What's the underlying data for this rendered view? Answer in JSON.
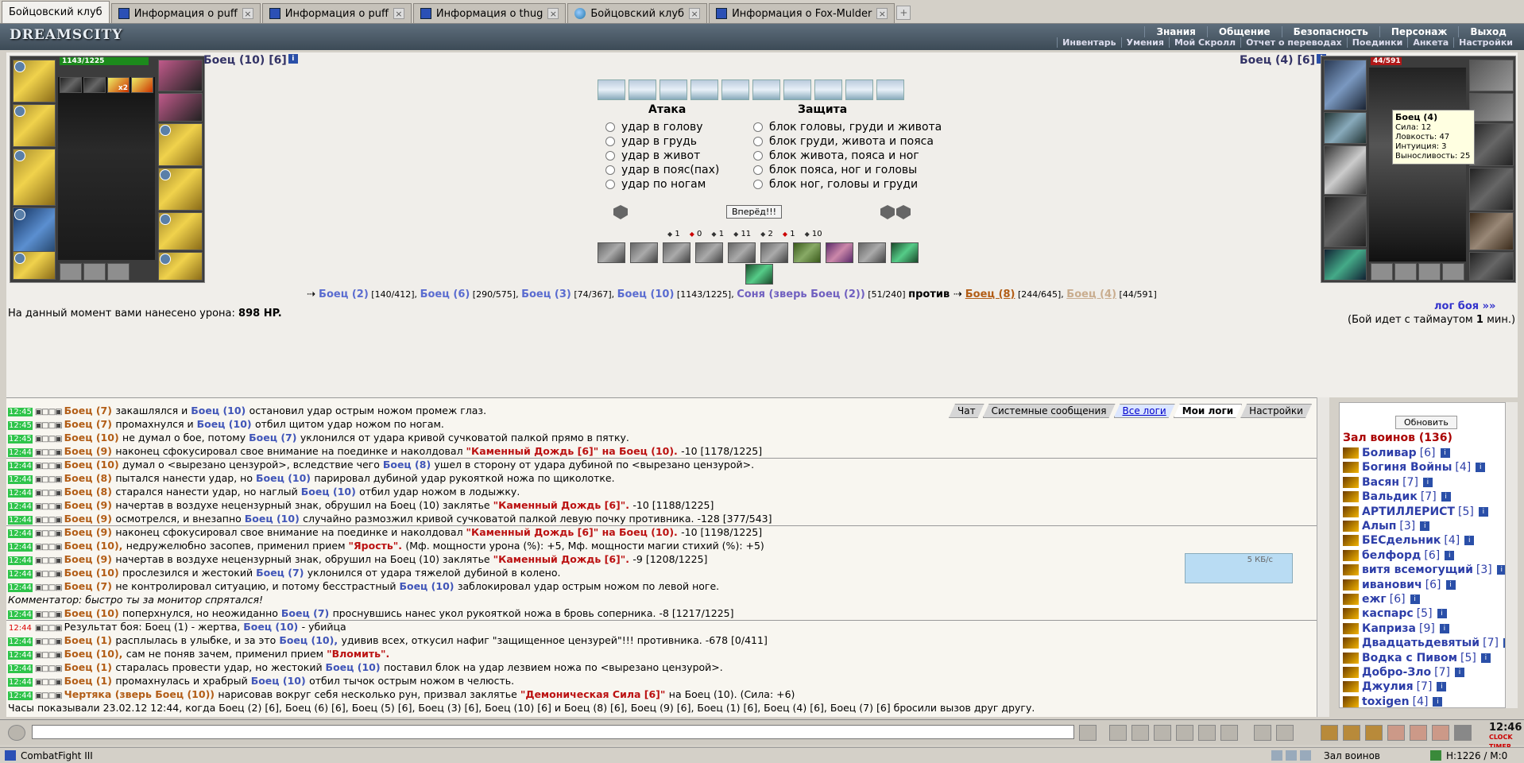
{
  "tabs": [
    {
      "label": "Бойцовский клуб",
      "icon": "dreamscity-icon"
    },
    {
      "label": "Информация о puff",
      "icon": "ie-icon"
    },
    {
      "label": "Информация о puff",
      "icon": "ie-icon"
    },
    {
      "label": "Информация о thug",
      "icon": "ie-icon"
    },
    {
      "label": "Бойцовский клуб",
      "icon": "globe-icon"
    },
    {
      "label": "Информация о Fox-Mulder",
      "icon": "ie-icon"
    }
  ],
  "header": {
    "logo": "DREAMSCITY",
    "menu_top": [
      "Знания",
      "Общение",
      "Безопасность",
      "Персонаж",
      "Выход"
    ],
    "menu_bottom": [
      "Инвентарь",
      "Умения",
      "Мой Скролл",
      "Отчет о переводах",
      "Поединки",
      "Анкета",
      "Настройки"
    ]
  },
  "player_left": {
    "name": "Боец (10) [6]",
    "hp": "1143/1225",
    "hp_fraction": 0.933,
    "buff": "x2"
  },
  "player_right": {
    "name": "Боец (4) [6]",
    "hp": "44/591",
    "hp_fraction": 0.074
  },
  "tooltip": {
    "title": "Боец (4)",
    "lines": [
      "Сила: 12",
      "Ловкость: 47",
      "Интуиция: 3",
      "Выносливость: 25"
    ]
  },
  "attack": {
    "title": "Атака",
    "options": [
      "удар в голову",
      "удар в грудь",
      "удар в живот",
      "удар в пояс(пах)",
      "удар по ногам"
    ]
  },
  "defense": {
    "title": "Защита",
    "options": [
      "блок головы, груди и живота",
      "блок груди, живота и пояса",
      "блок живота, пояса и ног",
      "блок пояса, ног и головы",
      "блок ног, головы и груди"
    ]
  },
  "go_button": "Вперёд!!!",
  "stats": [
    "1",
    "0",
    "1",
    "11",
    "2",
    "1",
    "10"
  ],
  "fighters": {
    "team1": [
      {
        "name": "Боец (2)",
        "hp": "[140/412]"
      },
      {
        "name": "Боец (6)",
        "hp": "[290/575]"
      },
      {
        "name": "Боец (3)",
        "hp": "[74/367]"
      },
      {
        "name": "Боец (10)",
        "hp": "[1143/1225]"
      },
      {
        "name": "Соня (зверь Боец (2))",
        "hp": "[51/240]"
      }
    ],
    "versus": "против",
    "team2": [
      {
        "name": "Боец (8)",
        "hp": "[244/645]"
      },
      {
        "name": "Боец (4)",
        "hp": "[44/591]"
      }
    ]
  },
  "damage": {
    "label": "На данный момент вами нанесено урона:",
    "value": "898 HP."
  },
  "log_link": "лог боя »»",
  "timeout": {
    "text": "(Бой идет с таймаутом",
    "num": "1",
    "unit": "мин.)"
  },
  "log_tabs": [
    "Чат",
    "Системные сообщения",
    "Все логи",
    "Мои логи",
    "Настройки"
  ],
  "log_lines": [
    {
      "t": "12:45",
      "a": "Боец (7)",
      "x": "закашлялся и",
      "b": "Боец (10)",
      "y": "остановил удар острым ножом промеж глаз."
    },
    {
      "t": "12:45",
      "a": "Боец (7)",
      "x": "промахнулся и",
      "b": "Боец (10)",
      "y": "отбил щитом удар ножом по ногам."
    },
    {
      "t": "12:45",
      "a": "Боец (10)",
      "x": "не думал о бое, потому",
      "b": "Боец (7)",
      "y": "уклонился от удара кривой сучковатой палкой прямо в пятку."
    },
    {
      "t": "12:44",
      "a": "Боец (9)",
      "x": "наконец сфокусировал свое внимание на поединке и наколдовал",
      "b": "\"Каменный Дождь [6]\" на Боец (10).",
      "y": "-10 [1178/1225]"
    },
    {
      "t": "12:44",
      "a": "Боец (10)",
      "x": "думал о <вырезано цензурой>, вследствие чего",
      "b": "Боец (8)",
      "y": "ушел в сторону от удара дубиной по <вырезано цензурой>."
    },
    {
      "t": "12:44",
      "a": "Боец (8)",
      "x": "пытался нанести удар, но",
      "b": "Боец (10)",
      "y": "парировал дубиной удар рукояткой ножа по щиколотке."
    },
    {
      "t": "12:44",
      "a": "Боец (8)",
      "x": "старался нанести удар, но наглый",
      "b": "Боец (10)",
      "y": "отбил удар ножом в лодыжку."
    },
    {
      "t": "12:44",
      "a": "Боец (9)",
      "x": "начертав в воздухе нецензурный знак, обрушил на Боец (10) заклятье",
      "b": "\"Каменный Дождь [6]\".",
      "y": "-10 [1188/1225]"
    },
    {
      "t": "12:44",
      "a": "Боец (9)",
      "x": "осмотрелся, и внезапно",
      "b": "Боец (10)",
      "y": "случайно размозжил кривой сучковатой палкой левую почку противника. -128 [377/543]"
    },
    {
      "t": "12:44",
      "a": "Боец (9)",
      "x": "наконец сфокусировал свое внимание на поединке и наколдовал",
      "b": "\"Каменный Дождь [6]\" на Боец (10).",
      "y": "-10 [1198/1225]"
    },
    {
      "t": "12:44",
      "a": "Боец (10),",
      "x": "недружелюбно засопев, применил прием",
      "b": "\"Ярость\".",
      "y": "(Мф. мощности урона (%): +5, Мф. мощности магии стихий (%): +5)"
    },
    {
      "t": "12:44",
      "a": "Боец (9)",
      "x": "начертав в воздухе нецензурный знак, обрушил на Боец (10) заклятье",
      "b": "\"Каменный Дождь [6]\".",
      "y": "-9 [1208/1225]"
    },
    {
      "t": "12:44",
      "a": "Боец (10)",
      "x": "прослезился и жестокий",
      "b": "Боец (7)",
      "y": "уклонился от удара тяжелой дубиной в колено."
    },
    {
      "t": "12:44",
      "a": "Боец (7)",
      "x": "не контролировал ситуацию, и потому бесстрастный",
      "b": "Боец (10)",
      "y": "заблокировал удар острым ножом по левой ноге."
    },
    {
      "t": "",
      "a": "",
      "x": "Комментатор: быстро ты за монитор спрятался!",
      "b": "",
      "y": ""
    },
    {
      "t": "12:44",
      "a": "Боец (10)",
      "x": "поперхнулся, но неожиданно",
      "b": "Боец (7)",
      "y": "проснувшись нанес укол рукояткой ножа в бровь соперника. -8 [1217/1225]"
    },
    {
      "t": "12:44",
      "a": "Результат боя:",
      "x": "Боец (1) - жертва,",
      "b": "Боец (10)",
      "y": "- убийца"
    },
    {
      "t": "12:44",
      "a": "Боец (1)",
      "x": "расплылась в улыбке, и за это",
      "b": "Боец (10),",
      "y": "удивив всех, откусил нафиг \"защищенное цензурей\"!!! противника. -678 [0/411]"
    },
    {
      "t": "12:44",
      "a": "Боец (10),",
      "x": "сам не поняв зачем, применил прием",
      "b": "\"Вломить\".",
      "y": ""
    },
    {
      "t": "12:44",
      "a": "Боец (1)",
      "x": "старалась провести удар, но жестокий",
      "b": "Боец (10)",
      "y": "поставил блок на удар лезвием ножа по <вырезано цензурой>."
    },
    {
      "t": "12:44",
      "a": "Боец (1)",
      "x": "промахнулась и храбрый",
      "b": "Боец (10)",
      "y": "отбил тычок острым ножом в челюсть."
    },
    {
      "t": "12:44",
      "a": "Чертяка (зверь Боец (10))",
      "x": "нарисовав вокруг себя несколько рун, призвал заклятье",
      "b": "\"Демоническая Сила [6]\"",
      "y": "на Боец (10). (Сила: +6)"
    },
    {
      "t": "",
      "a": "",
      "x": "Часы показывали 23.02.12 12:44, когда Боец (2) [6], Боец (6) [6], Боец (5) [6], Боец (3) [6], Боец (10) [6] и Боец (8) [6], Боец (9) [6], Боец (1) [6], Боец (4) [6], Боец (7) [6]",
      "b": "",
      "y": "бросили вызов друг другу."
    }
  ],
  "right_panel": {
    "refresh": "Обновить",
    "hall_title": "Зал воинов (136)",
    "users": [
      {
        "name": "Боливар",
        "lvl": "[6]"
      },
      {
        "name": "Богиня Войны",
        "lvl": "[4]"
      },
      {
        "name": "Васян",
        "lvl": "[7]"
      },
      {
        "name": "Вальдик",
        "lvl": "[7]"
      },
      {
        "name": "АРТИЛЛЕРИСТ",
        "lvl": "[5]"
      },
      {
        "name": "Алып",
        "lvl": "[3]"
      },
      {
        "name": "БЕСдельник",
        "lvl": "[4]"
      },
      {
        "name": "белфорд",
        "lvl": "[6]"
      },
      {
        "name": "витя всемогущий",
        "lvl": "[3]"
      },
      {
        "name": "иванович",
        "lvl": "[6]"
      },
      {
        "name": "ежг",
        "lvl": "[6]"
      },
      {
        "name": "каспарс",
        "lvl": "[5]"
      },
      {
        "name": "Каприза",
        "lvl": "[9]"
      },
      {
        "name": "Двадцатьдевятый",
        "lvl": "[7]"
      },
      {
        "name": "Водка с Пивом",
        "lvl": "[5]"
      },
      {
        "name": "Добро-Зло",
        "lvl": "[7]"
      },
      {
        "name": "Джулия",
        "lvl": "[7]"
      },
      {
        "name": "toxigen",
        "lvl": "[4]"
      }
    ]
  },
  "kb_label": "5 КБ/с",
  "clock": {
    "time": "12:46",
    "labels": [
      "CLOCK",
      "TIMER"
    ]
  },
  "status": {
    "app": "CombatFight III",
    "room": "Зал воинов",
    "hp": "H:1226 / M:0"
  }
}
